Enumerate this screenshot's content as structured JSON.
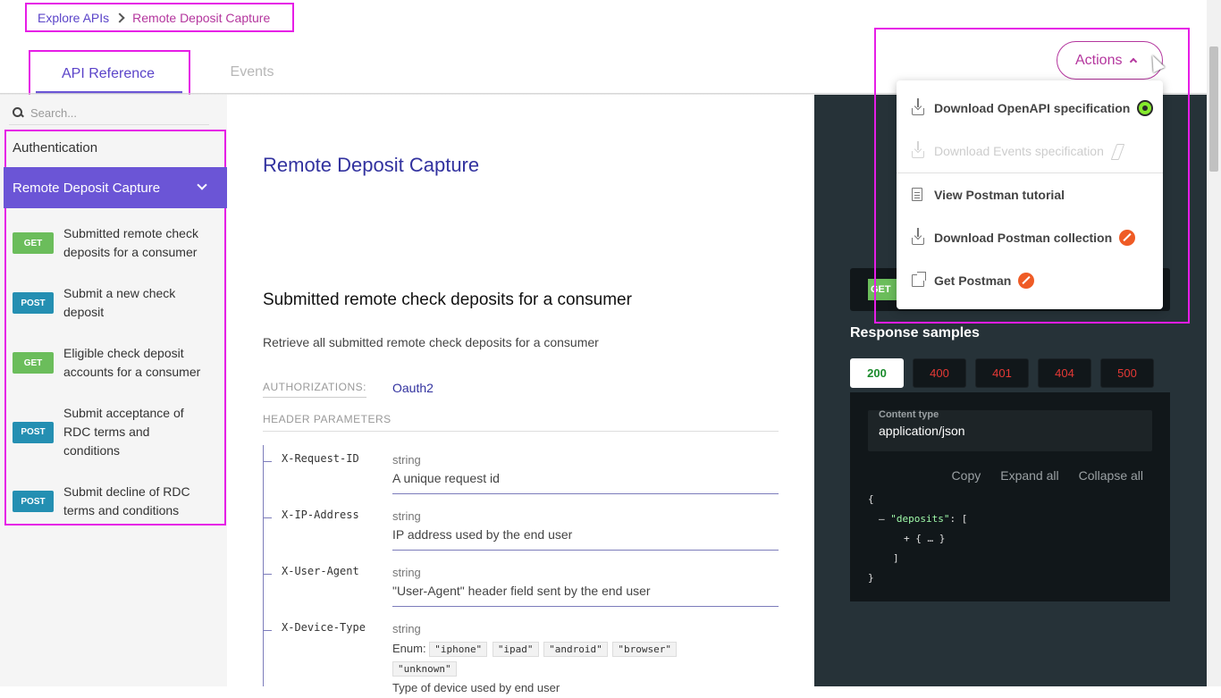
{
  "breadcrumb": {
    "root": "Explore APIs",
    "current": "Remote Deposit Capture"
  },
  "tabs": [
    {
      "label": "API Reference",
      "active": true
    },
    {
      "label": "Events",
      "active": false
    }
  ],
  "sidebar": {
    "search_placeholder": "Search...",
    "auth_label": "Authentication",
    "section_label": "Remote Deposit Capture",
    "operations": [
      {
        "method": "GET",
        "label": "Submitted remote check deposits for a consumer"
      },
      {
        "method": "POST",
        "label": "Submit a new check deposit"
      },
      {
        "method": "GET",
        "label": "Eligible check deposit accounts for a consumer"
      },
      {
        "method": "POST",
        "label": "Submit acceptance of RDC terms and conditions"
      },
      {
        "method": "POST",
        "label": "Submit decline of RDC terms and conditions"
      }
    ]
  },
  "main": {
    "page_title": "Remote Deposit Capture",
    "operation_title": "Submitted remote check deposits for a consumer",
    "operation_desc": "Retrieve all submitted remote check deposits for a consumer",
    "auth_label": "AUTHORIZATIONS:",
    "auth_value": "Oauth2",
    "header_params_label": "HEADER PARAMETERS",
    "params": [
      {
        "name": "X-Request-ID",
        "type": "string",
        "desc": "A unique request id"
      },
      {
        "name": "X-IP-Address",
        "type": "string",
        "desc": "IP address used by the end user"
      },
      {
        "name": "X-User-Agent",
        "type": "string",
        "desc": "\"User-Agent\" header field sent by the end user"
      },
      {
        "name": "X-Device-Type",
        "type": "string",
        "enum_label": "Enum:",
        "enum": [
          "\"iphone\"",
          "\"ipad\"",
          "\"android\"",
          "\"browser\"",
          "\"unknown\""
        ],
        "desc": "Type of device used by end user"
      }
    ]
  },
  "right_panel": {
    "endpoint_method": "GET",
    "response_title": "Response samples",
    "status_codes": [
      "200",
      "400",
      "401",
      "404",
      "500"
    ],
    "active_status": "200",
    "content_type_label": "Content type",
    "content_type_value": "application/json",
    "code_actions": [
      "Copy",
      "Expand all",
      "Collapse all"
    ],
    "json_lines": {
      "open": "{",
      "key_prefix": "– ",
      "key": "\"deposits\"",
      "key_suffix": ": [",
      "item": "+ { … }",
      "close_arr": "]",
      "close": "}"
    }
  },
  "actions": {
    "button_label": "Actions",
    "menu": [
      {
        "label": "Download OpenAPI specification",
        "icon": "download-icon",
        "badge": "openapi-icon",
        "disabled": false
      },
      {
        "label": "Download Events specification",
        "icon": "download-icon",
        "badge": "bolt-icon",
        "disabled": true
      },
      {
        "label": "View Postman tutorial",
        "icon": "document-icon",
        "badge": null,
        "disabled": false
      },
      {
        "label": "Download Postman collection",
        "icon": "download-icon",
        "badge": "postman-icon",
        "disabled": false
      },
      {
        "label": "Get Postman",
        "icon": "external-link-icon",
        "badge": "postman-icon",
        "disabled": false
      }
    ]
  },
  "colors": {
    "accent_purple": "#6b55d6",
    "highlight_frame": "#e61de6",
    "get_badge": "#6bbd5b",
    "post_badge": "#248fb2",
    "dark_panel": "#263238",
    "actions_magenta": "#b4369e"
  }
}
